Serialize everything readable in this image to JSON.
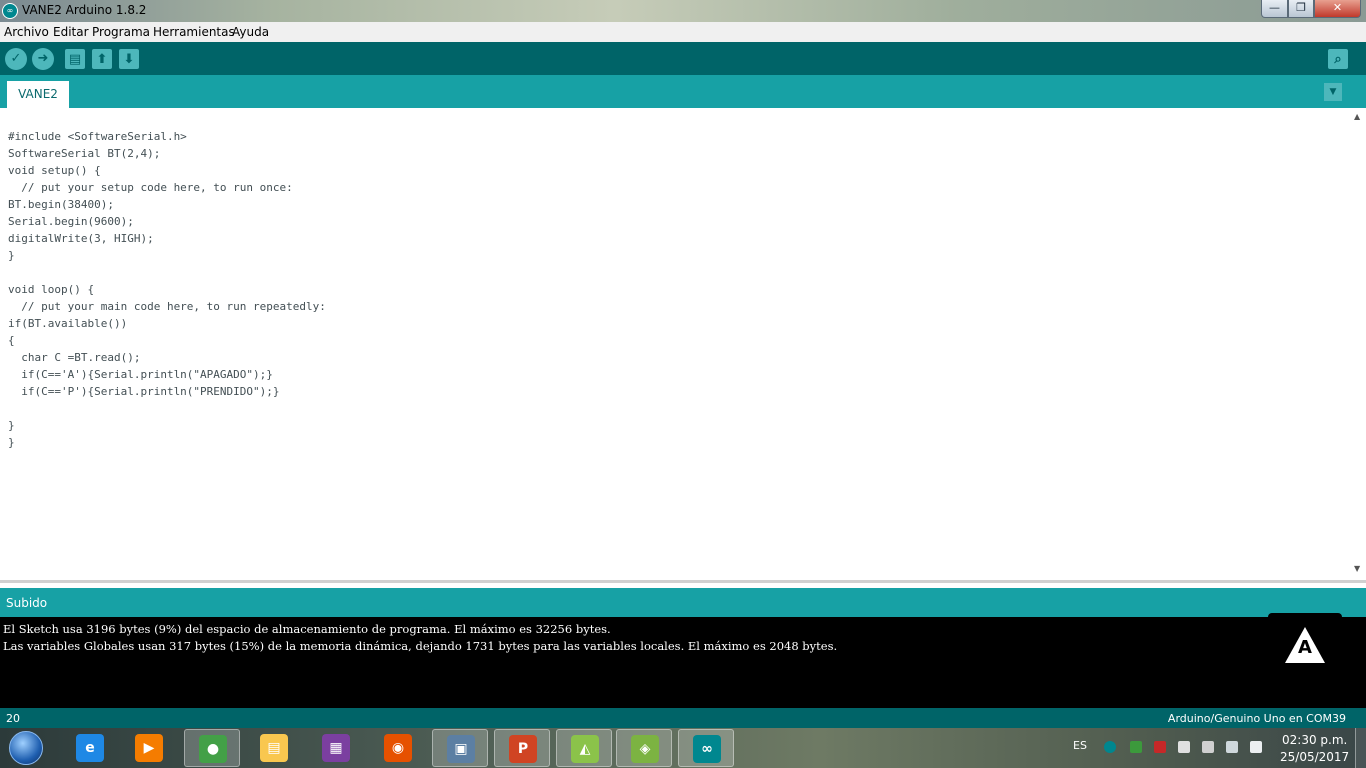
{
  "window": {
    "title": "VANE2 Arduino 1.8.2",
    "controls": {
      "minimize": "—",
      "maximize": "❐",
      "close": "✕"
    }
  },
  "menu": {
    "items": [
      "Archivo",
      "Editar",
      "Programa",
      "Herramientas",
      "Ayuda"
    ]
  },
  "toolbar": {
    "verify_icon": "check-icon",
    "upload_icon": "arrow-right-icon",
    "new_icon": "document-icon",
    "open_icon": "arrow-up-icon",
    "save_icon": "arrow-down-icon",
    "serial_monitor_icon": "magnifier-icon"
  },
  "tabs": {
    "active": "VANE2",
    "menu_icon": "chevron-down-icon"
  },
  "editor": {
    "lines": [
      "#include <SoftwareSerial.h>",
      "SoftwareSerial BT(2,4);",
      "void setup() {",
      "  // put your setup code here, to run once:",
      "BT.begin(38400);",
      "Serial.begin(9600);",
      "digitalWrite(3, HIGH);",
      "}",
      "",
      "void loop() {",
      "  // put your main code here, to run repeatedly:",
      "if(BT.available())",
      "{",
      "  char C =BT.read();",
      "  if(C=='A'){Serial.println(\"APAGADO\");}",
      "  if(C=='P'){Serial.println(\"PRENDIDO\");}",
      "",
      "}",
      "}"
    ]
  },
  "status": {
    "message": "Subido"
  },
  "console": {
    "lines": [
      "El Sketch usa 3196 bytes (9%) del espacio de almacenamiento de programa. El máximo es 32256 bytes.",
      "Las variables Globales usan 317 bytes (15%) de la memoria dinámica, dejando 1731 bytes para las variables locales. El máximo es 2048 bytes."
    ],
    "badge_letter": "A"
  },
  "footer": {
    "line_number": "20",
    "board": "Arduino/Genuino Uno en COM39"
  },
  "taskbar": {
    "apps": [
      {
        "name": "internet-explorer",
        "glyph": "e",
        "color": "#1e88e5",
        "open": false
      },
      {
        "name": "media-player",
        "glyph": "▶",
        "color": "#f57c00",
        "open": false
      },
      {
        "name": "chrome",
        "glyph": "●",
        "color": "#43a047",
        "open": true
      },
      {
        "name": "file-explorer",
        "glyph": "▤",
        "color": "#f9c74f",
        "open": false
      },
      {
        "name": "winrar",
        "glyph": "▦",
        "color": "#7b3fa0",
        "open": false
      },
      {
        "name": "firefox",
        "glyph": "◉",
        "color": "#e65100",
        "open": false
      },
      {
        "name": "remote-desktop",
        "glyph": "▣",
        "color": "#5c7fa3",
        "open": true
      },
      {
        "name": "powerpoint",
        "glyph": "P",
        "color": "#d04423",
        "open": true
      },
      {
        "name": "android-emulator",
        "glyph": "◭",
        "color": "#8bc34a",
        "open": true
      },
      {
        "name": "android-studio",
        "glyph": "◈",
        "color": "#7cb342",
        "open": true
      },
      {
        "name": "arduino",
        "glyph": "∞",
        "color": "#00878f",
        "open": true
      }
    ],
    "tray": {
      "language": "ES",
      "time": "02:30 p.m.",
      "date": "25/05/2017"
    }
  }
}
